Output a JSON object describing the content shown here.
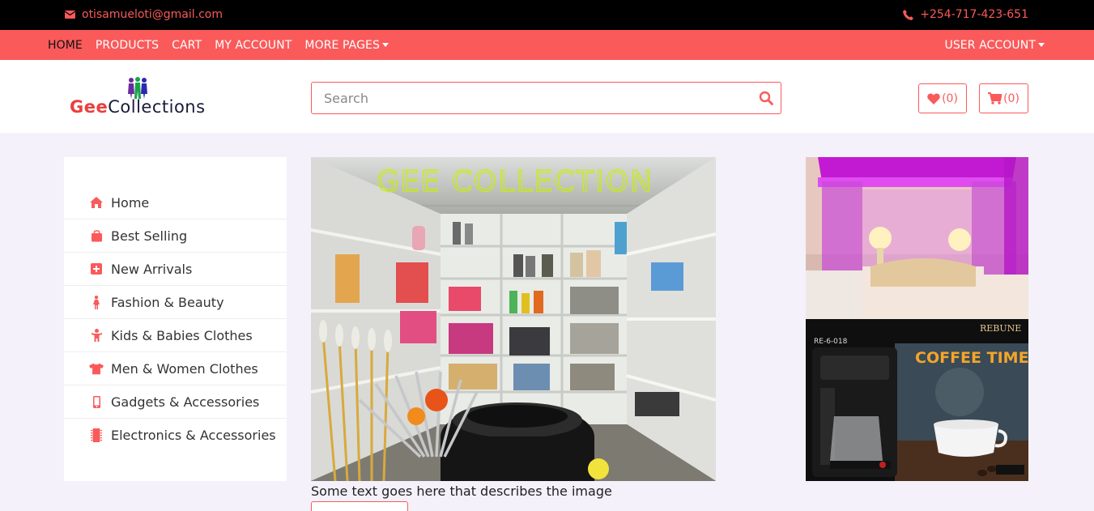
{
  "topbar": {
    "email": "otisamueloti@gmail.com",
    "phone": "+254-717-423-651",
    "email_icon": "envelope-icon",
    "phone_icon": "phone-icon"
  },
  "nav": {
    "items": [
      "HOME",
      "PRODUCTS",
      "CART",
      "MY ACCOUNT",
      "MORE PAGES"
    ],
    "active": "HOME",
    "user_account": "USER ACCOUNT"
  },
  "brand": {
    "name_part1": "Gee",
    "name_part2": "Collections"
  },
  "search": {
    "placeholder": "Search",
    "icon": "search-icon"
  },
  "counters": {
    "wishlist": "(0)",
    "cart": "(0)"
  },
  "sidebar": {
    "items": [
      {
        "label": "Home",
        "icon": "home-icon"
      },
      {
        "label": "Best Selling",
        "icon": "shopping-bag-icon"
      },
      {
        "label": "New Arrivals",
        "icon": "plus-square-icon"
      },
      {
        "label": "Fashion & Beauty",
        "icon": "female-icon"
      },
      {
        "label": "Kids & Babies Clothes",
        "icon": "child-icon"
      },
      {
        "label": "Men & Women Clothes",
        "icon": "tshirt-icon"
      },
      {
        "label": "Gadgets & Accessories",
        "icon": "mobile-icon"
      },
      {
        "label": "Electronics & Accessories",
        "icon": "microchip-icon"
      }
    ]
  },
  "hero": {
    "overlay_text": "GEE COLLECTION",
    "caption": "Some text goes here that describes the image"
  },
  "promos": {
    "coffee_brand": "REBUNE",
    "coffee_model": "RE-6-018",
    "coffee_headline": "COFFEE TIME!"
  },
  "colors": {
    "accent": "#fa5a5a",
    "topbar": "#000000",
    "background": "#f4f1fb",
    "hero_text": "#c8f000"
  }
}
